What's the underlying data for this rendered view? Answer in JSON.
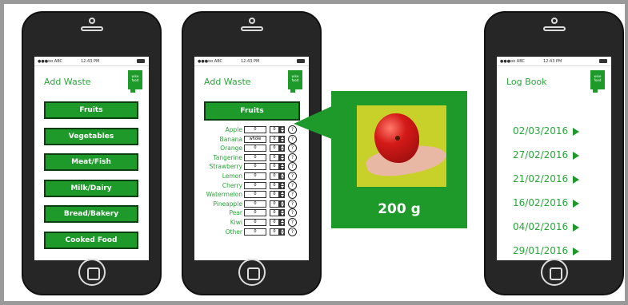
{
  "status": {
    "carrier": "●●●oo ABC",
    "time": "12:43 PM"
  },
  "logo_text": [
    "wise",
    "food"
  ],
  "screen1": {
    "title": "Add Waste",
    "categories": [
      "Fruits",
      "Vegetables",
      "Meat/Fish",
      "Milk/Dairy",
      "Bread/Bakery",
      "Cooked Food"
    ]
  },
  "screen2": {
    "title": "Add Waste",
    "header": "Fruits",
    "info_symbol": "?",
    "fruits": [
      {
        "name": "Apple",
        "weight": "0",
        "qty": "0"
      },
      {
        "name": "Banana",
        "weight": "whole",
        "qty": "0"
      },
      {
        "name": "Orange",
        "weight": "0",
        "qty": "0"
      },
      {
        "name": "Tangerine",
        "weight": "0",
        "qty": "0"
      },
      {
        "name": "Strawberry",
        "weight": "0",
        "qty": "0"
      },
      {
        "name": "Lemon",
        "weight": "0",
        "qty": "0"
      },
      {
        "name": "Cherry",
        "weight": "0",
        "qty": "0"
      },
      {
        "name": "Watermelon",
        "weight": "0",
        "qty": "0"
      },
      {
        "name": "Pineapple",
        "weight": "0",
        "qty": "0"
      },
      {
        "name": "Pear",
        "weight": "0",
        "qty": "0"
      },
      {
        "name": "Kiwi",
        "weight": "0",
        "qty": "0"
      },
      {
        "name": "Other",
        "weight": "0",
        "qty": "0"
      }
    ]
  },
  "popup": {
    "weight": "200 g"
  },
  "screen3": {
    "title": "Log Book",
    "dates": [
      "02/03/2016",
      "27/02/2016",
      "21/02/2016",
      "16/02/2016",
      "04/02/2016",
      "29/01/2016"
    ]
  },
  "colors": {
    "brand_green": "#1d9a2a",
    "text_green": "#29a63a",
    "phone_body": "#262626"
  }
}
